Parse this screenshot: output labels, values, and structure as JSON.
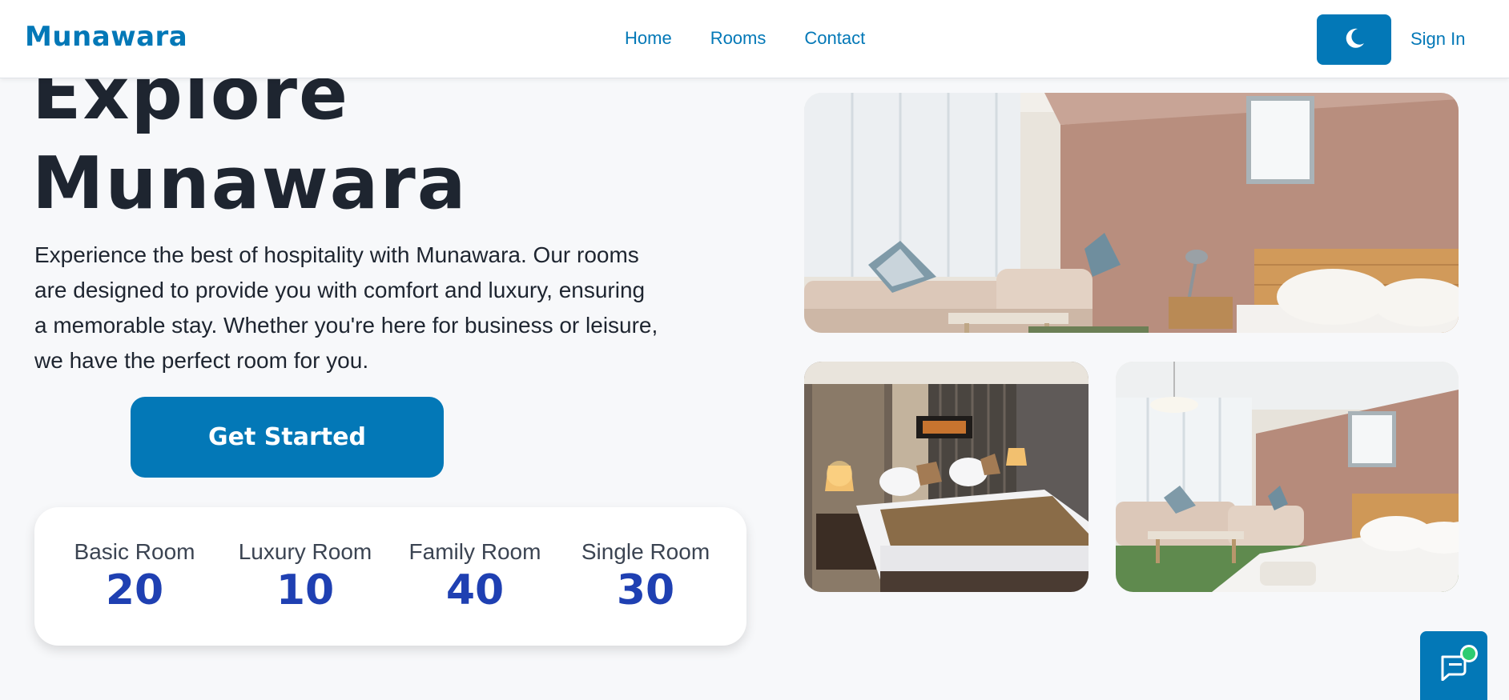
{
  "nav": {
    "brand": "Munawara",
    "links": [
      "Home",
      "Rooms",
      "Contact"
    ],
    "theme_toggle_icon": "moon-icon",
    "sign_in": "Sign In"
  },
  "hero": {
    "title_line1": "Explore",
    "title_line2": "Munawara",
    "description": "Experience the best of hospitality with Munawara. Our rooms are designed to provide you with comfort and luxury, ensuring a memorable stay. Whether you're here for business or leisure, we have the perfect room for you.",
    "cta": "Get Started"
  },
  "stats": [
    {
      "label": "Basic Room",
      "value": "20"
    },
    {
      "label": "Luxury Room",
      "value": "10"
    },
    {
      "label": "Family Room",
      "value": "40"
    },
    {
      "label": "Single Room",
      "value": "30"
    }
  ],
  "chat": {
    "icon": "chat-icon"
  },
  "colors": {
    "brand": "#0378b7",
    "stat_value": "#1f40b2",
    "heading": "#1e2530",
    "background": "#f7f8fa",
    "online_indicator": "#2ecc71"
  }
}
